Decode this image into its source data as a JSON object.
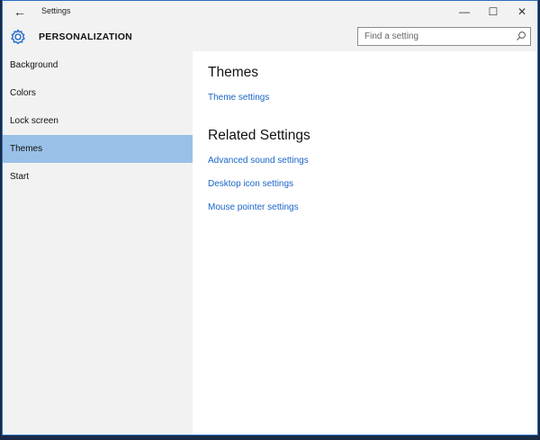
{
  "window": {
    "title": "Settings",
    "back_glyph": "←",
    "minimize_glyph": "—",
    "maximize_glyph": "☐",
    "close_glyph": "✕"
  },
  "header": {
    "icon": "gear-icon",
    "title": "PERSONALIZATION",
    "search_placeholder": "Find a setting",
    "search_icon": "search-icon"
  },
  "sidebar": {
    "items": [
      {
        "label": "Background",
        "active": false
      },
      {
        "label": "Colors",
        "active": false
      },
      {
        "label": "Lock screen",
        "active": false
      },
      {
        "label": "Themes",
        "active": true
      },
      {
        "label": "Start",
        "active": false
      }
    ],
    "active_color": "#99c1e8"
  },
  "main": {
    "themes_heading": "Themes",
    "theme_settings_link": "Theme settings",
    "related_heading": "Related Settings",
    "related_links": [
      "Advanced sound settings",
      "Desktop icon settings",
      "Mouse pointer settings"
    ]
  },
  "colors": {
    "accent": "#1a64c8",
    "chrome": "#f2f2f2",
    "desktop": "#1a2a44"
  }
}
